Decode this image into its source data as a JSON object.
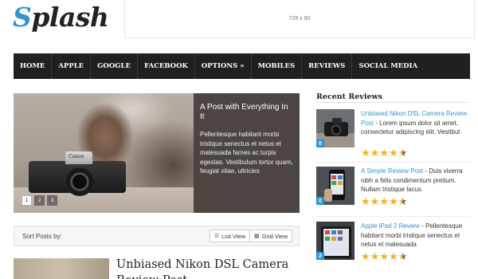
{
  "header": {
    "logo_first": "S",
    "logo_rest": "plash",
    "ad_text": "728 x 90"
  },
  "nav": {
    "items": [
      {
        "label": "HOME"
      },
      {
        "label": "APPLE"
      },
      {
        "label": "GOOGLE"
      },
      {
        "label": "FACEBOOK"
      },
      {
        "label": "OPTIONS »"
      },
      {
        "label": "MOBILES"
      },
      {
        "label": "REVIEWS"
      },
      {
        "label": "SOCIAL MEDIA"
      }
    ]
  },
  "slider": {
    "title": "A Post with Everything In It",
    "excerpt": "Pellentesque habitant morbi tristique senectus et netus et malesuada fames ac turpis egestas. Vestibulum tortor quam, feugiat vitae, ultricies",
    "camera_brand": "Canon",
    "pages": [
      "1",
      "2",
      "3"
    ],
    "active_page": 1
  },
  "sortbar": {
    "label": "Sort Posts by:",
    "list_view": "List View",
    "grid_view": "Grid View"
  },
  "post": {
    "title": "Unbiased Nikon DSL Camera Review Post"
  },
  "sidebar": {
    "title": "Recent Reviews",
    "reviews": [
      {
        "link": "Unbiased Nikon DSL Camera Review Post",
        "excerpt": " - Lorem ipsum dolor sit amet, consectetur adipiscing elit. Vestibul",
        "badge": "0",
        "rating": 4.5
      },
      {
        "link": "A Simple Review Post",
        "excerpt": " - Duis viverra nibh a felis condimentum pretium. Nullam tristique lacus",
        "badge": "0",
        "rating": 4.5
      },
      {
        "link": "Apple iPad 2 Review",
        "excerpt": " - Pellentesque habitant morbi tristique senectus et netus et malesuada",
        "badge": "2",
        "rating": 4.5
      }
    ]
  },
  "colors": {
    "accent": "#2b95d2",
    "nav_bg": "#202020",
    "star": "#f2b31a"
  }
}
